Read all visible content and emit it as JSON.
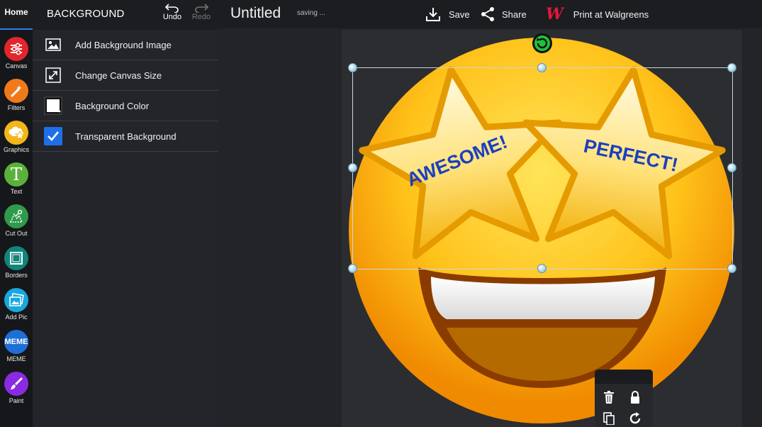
{
  "rail": {
    "home": "Home",
    "tools": [
      {
        "label": "Canvas",
        "color": "#e3262b",
        "icon": "sliders-icon"
      },
      {
        "label": "Filters",
        "color": "#f07a1a",
        "icon": "magic-wand-icon"
      },
      {
        "label": "Graphics",
        "color": "#f2b51a",
        "icon": "shapes-icon"
      },
      {
        "label": "Text",
        "color": "#5bb13a",
        "icon": "text-T-icon"
      },
      {
        "label": "Cut Out",
        "color": "#2e9a4a",
        "icon": "cutout-icon"
      },
      {
        "label": "Borders",
        "color": "#10857c",
        "icon": "frame-icon"
      },
      {
        "label": "Add Pic",
        "color": "#1aa7e0",
        "icon": "photo-icon"
      },
      {
        "label": "MEME",
        "color": "#1f6fd8",
        "icon": "meme-icon"
      },
      {
        "label": "Paint",
        "color": "#8a2be2",
        "icon": "brush-icon"
      }
    ]
  },
  "panel": {
    "title": "BACKGROUND",
    "undo": "Undo",
    "redo": "Redo",
    "items": [
      {
        "label": "Add Background Image",
        "icon": "image-icon"
      },
      {
        "label": "Change Canvas Size",
        "icon": "resize-icon"
      },
      {
        "label": "Background Color",
        "icon": "color-swatch-icon"
      },
      {
        "label": "Transparent Background",
        "icon": "checkbox-icon",
        "checked": true
      }
    ]
  },
  "topbar": {
    "doc_title": "Untitled",
    "status": "saving ...",
    "save": "Save",
    "share": "Share",
    "print": "Print at Walgreens"
  },
  "emoji": {
    "left_star": "AWESOME!",
    "right_star": "PERFECT!"
  },
  "colors": {
    "accent": "#2f80ed",
    "walgreens": "#e31837",
    "text_on_star": "#1c3fbf"
  }
}
